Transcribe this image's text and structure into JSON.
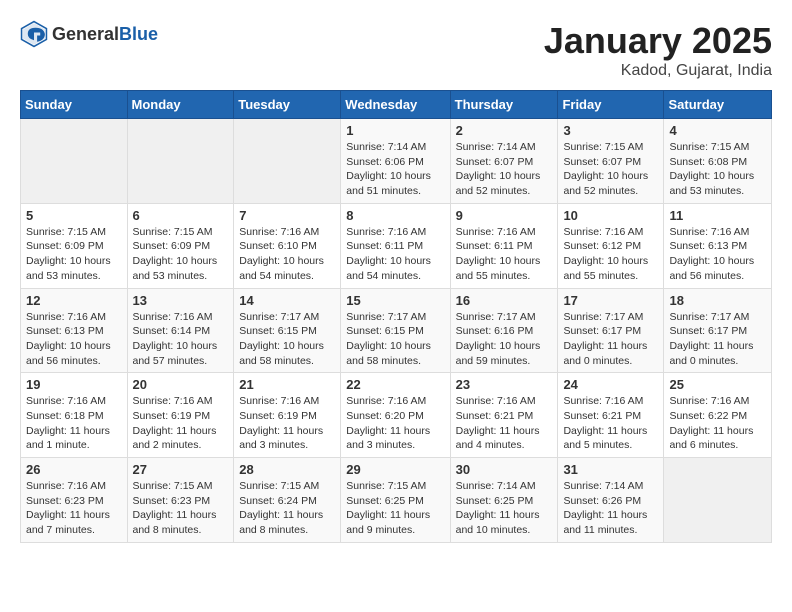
{
  "logo": {
    "general": "General",
    "blue": "Blue"
  },
  "title": "January 2025",
  "subtitle": "Kadod, Gujarat, India",
  "headers": [
    "Sunday",
    "Monday",
    "Tuesday",
    "Wednesday",
    "Thursday",
    "Friday",
    "Saturday"
  ],
  "weeks": [
    [
      {
        "day": "",
        "info": ""
      },
      {
        "day": "",
        "info": ""
      },
      {
        "day": "",
        "info": ""
      },
      {
        "day": "1",
        "info": "Sunrise: 7:14 AM\nSunset: 6:06 PM\nDaylight: 10 hours\nand 51 minutes."
      },
      {
        "day": "2",
        "info": "Sunrise: 7:14 AM\nSunset: 6:07 PM\nDaylight: 10 hours\nand 52 minutes."
      },
      {
        "day": "3",
        "info": "Sunrise: 7:15 AM\nSunset: 6:07 PM\nDaylight: 10 hours\nand 52 minutes."
      },
      {
        "day": "4",
        "info": "Sunrise: 7:15 AM\nSunset: 6:08 PM\nDaylight: 10 hours\nand 53 minutes."
      }
    ],
    [
      {
        "day": "5",
        "info": "Sunrise: 7:15 AM\nSunset: 6:09 PM\nDaylight: 10 hours\nand 53 minutes."
      },
      {
        "day": "6",
        "info": "Sunrise: 7:15 AM\nSunset: 6:09 PM\nDaylight: 10 hours\nand 53 minutes."
      },
      {
        "day": "7",
        "info": "Sunrise: 7:16 AM\nSunset: 6:10 PM\nDaylight: 10 hours\nand 54 minutes."
      },
      {
        "day": "8",
        "info": "Sunrise: 7:16 AM\nSunset: 6:11 PM\nDaylight: 10 hours\nand 54 minutes."
      },
      {
        "day": "9",
        "info": "Sunrise: 7:16 AM\nSunset: 6:11 PM\nDaylight: 10 hours\nand 55 minutes."
      },
      {
        "day": "10",
        "info": "Sunrise: 7:16 AM\nSunset: 6:12 PM\nDaylight: 10 hours\nand 55 minutes."
      },
      {
        "day": "11",
        "info": "Sunrise: 7:16 AM\nSunset: 6:13 PM\nDaylight: 10 hours\nand 56 minutes."
      }
    ],
    [
      {
        "day": "12",
        "info": "Sunrise: 7:16 AM\nSunset: 6:13 PM\nDaylight: 10 hours\nand 56 minutes."
      },
      {
        "day": "13",
        "info": "Sunrise: 7:16 AM\nSunset: 6:14 PM\nDaylight: 10 hours\nand 57 minutes."
      },
      {
        "day": "14",
        "info": "Sunrise: 7:17 AM\nSunset: 6:15 PM\nDaylight: 10 hours\nand 58 minutes."
      },
      {
        "day": "15",
        "info": "Sunrise: 7:17 AM\nSunset: 6:15 PM\nDaylight: 10 hours\nand 58 minutes."
      },
      {
        "day": "16",
        "info": "Sunrise: 7:17 AM\nSunset: 6:16 PM\nDaylight: 10 hours\nand 59 minutes."
      },
      {
        "day": "17",
        "info": "Sunrise: 7:17 AM\nSunset: 6:17 PM\nDaylight: 11 hours\nand 0 minutes."
      },
      {
        "day": "18",
        "info": "Sunrise: 7:17 AM\nSunset: 6:17 PM\nDaylight: 11 hours\nand 0 minutes."
      }
    ],
    [
      {
        "day": "19",
        "info": "Sunrise: 7:16 AM\nSunset: 6:18 PM\nDaylight: 11 hours\nand 1 minute."
      },
      {
        "day": "20",
        "info": "Sunrise: 7:16 AM\nSunset: 6:19 PM\nDaylight: 11 hours\nand 2 minutes."
      },
      {
        "day": "21",
        "info": "Sunrise: 7:16 AM\nSunset: 6:19 PM\nDaylight: 11 hours\nand 3 minutes."
      },
      {
        "day": "22",
        "info": "Sunrise: 7:16 AM\nSunset: 6:20 PM\nDaylight: 11 hours\nand 3 minutes."
      },
      {
        "day": "23",
        "info": "Sunrise: 7:16 AM\nSunset: 6:21 PM\nDaylight: 11 hours\nand 4 minutes."
      },
      {
        "day": "24",
        "info": "Sunrise: 7:16 AM\nSunset: 6:21 PM\nDaylight: 11 hours\nand 5 minutes."
      },
      {
        "day": "25",
        "info": "Sunrise: 7:16 AM\nSunset: 6:22 PM\nDaylight: 11 hours\nand 6 minutes."
      }
    ],
    [
      {
        "day": "26",
        "info": "Sunrise: 7:16 AM\nSunset: 6:23 PM\nDaylight: 11 hours\nand 7 minutes."
      },
      {
        "day": "27",
        "info": "Sunrise: 7:15 AM\nSunset: 6:23 PM\nDaylight: 11 hours\nand 8 minutes."
      },
      {
        "day": "28",
        "info": "Sunrise: 7:15 AM\nSunset: 6:24 PM\nDaylight: 11 hours\nand 8 minutes."
      },
      {
        "day": "29",
        "info": "Sunrise: 7:15 AM\nSunset: 6:25 PM\nDaylight: 11 hours\nand 9 minutes."
      },
      {
        "day": "30",
        "info": "Sunrise: 7:14 AM\nSunset: 6:25 PM\nDaylight: 11 hours\nand 10 minutes."
      },
      {
        "day": "31",
        "info": "Sunrise: 7:14 AM\nSunset: 6:26 PM\nDaylight: 11 hours\nand 11 minutes."
      },
      {
        "day": "",
        "info": ""
      }
    ]
  ]
}
